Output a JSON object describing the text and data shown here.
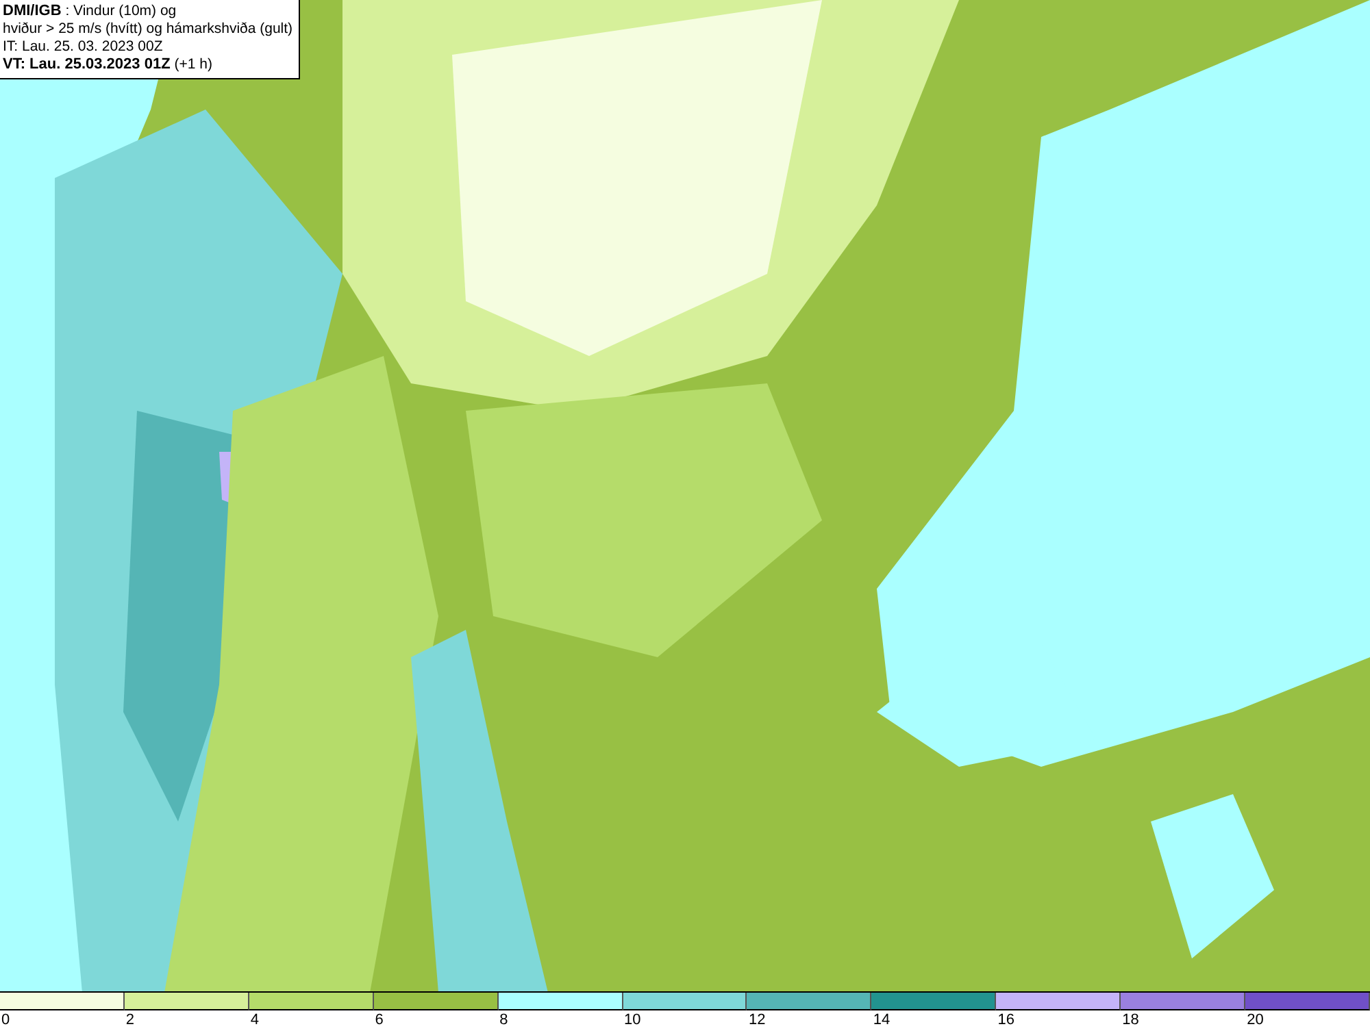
{
  "title_box": {
    "lines": [
      "**DMI/IGB** : Vindur (10m) og",
      "hviður > 25 m/s (hvítt) og hámarkshviða (gult)",
      "IT: Lau. 25. 03. 2023 00Z",
      "**VT: Lau. 25.03.2023 01Z** (+1 h)"
    ]
  },
  "legend": {
    "segments": [
      {
        "color": "#f5fde0",
        "tick": "0"
      },
      {
        "color": "#d6f09a",
        "tick": "2"
      },
      {
        "color": "#b5dc6a",
        "tick": "4"
      },
      {
        "color": "#98c044",
        "tick": "6"
      },
      {
        "color": "#aaffff",
        "tick": "8"
      },
      {
        "color": "#7fd8d8",
        "tick": "10"
      },
      {
        "color": "#55b5b5",
        "tick": "12"
      },
      {
        "color": "#22938f",
        "tick": "14"
      },
      {
        "color": "#c4b4f8",
        "tick": "16"
      },
      {
        "color": "#9a80e0",
        "tick": "18"
      },
      {
        "color": "#7050c8",
        "tick": "20"
      }
    ]
  }
}
